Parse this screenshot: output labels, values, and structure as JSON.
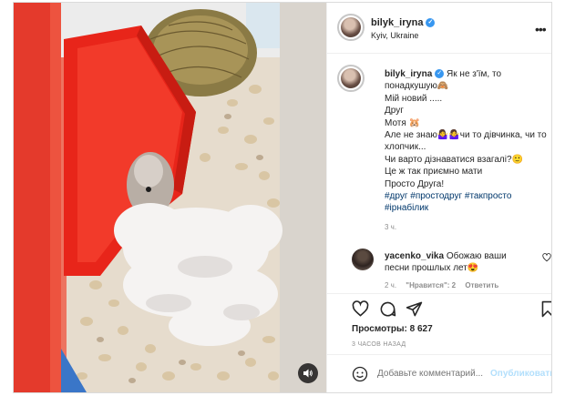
{
  "post": {
    "author": "bilyk_iryna",
    "location": "Kyiv, Ukraine",
    "more_label": "•••",
    "caption_lines": [
      "Як не з'їм, то",
      "понадкушую🙈",
      "Мій новий .....",
      "Друг",
      "Мотя 🐹",
      "Але не знаю🤷‍♀️🤷‍♀️чи то дівчинка, чи то",
      "хлопчик...",
      "Чи варто дізнаватися взагалі?🙂",
      "Це ж так приємно мати",
      "Просто Друга!"
    ],
    "hashtags_line1": "#друг #простодруг #такпросто",
    "hashtags_line2": "#ірнабілик",
    "caption_time": "3 ч.",
    "comment": {
      "author": "yacenko_vika",
      "text_line1": "Обожаю ваши",
      "text_line2": "песни прошлых лет😍",
      "time": "2 ч.",
      "likes": "\"Нравится\": 2",
      "reply": "Ответить"
    },
    "likes_text": "Просмотры: 8 627",
    "posted_ago": "3 ЧАСОВ НАЗАД",
    "comment_placeholder": "Добавьте комментарий...",
    "publish_label": "Опубликовать"
  },
  "icons": {
    "verified": "verified-badge-icon",
    "mute": "speaker-icon",
    "like": "heart-icon",
    "comment": "comment-bubble-icon",
    "share": "paper-plane-icon",
    "save": "bookmark-icon",
    "emoji": "smiley-icon"
  },
  "colors": {
    "verified_blue": "#3897f0",
    "hashtag": "#00376b",
    "publish_disabled": "#b2dffc",
    "secondary_text": "#8e8e8e"
  }
}
